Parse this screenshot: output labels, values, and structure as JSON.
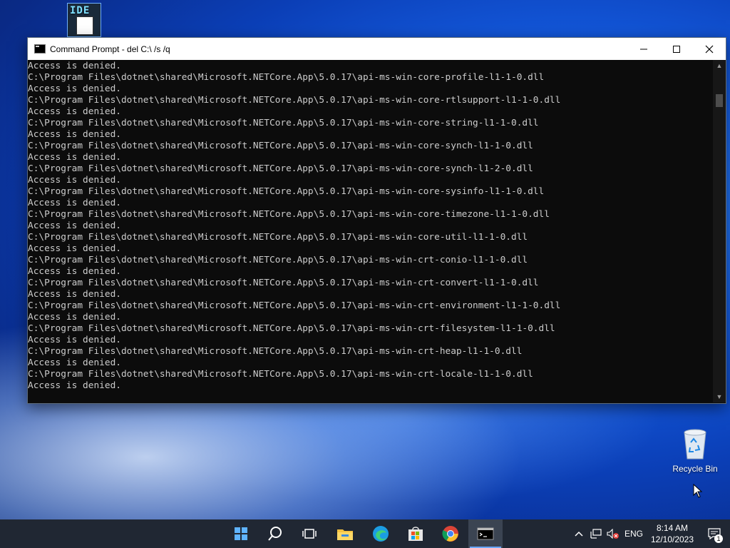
{
  "desktop": {
    "icons": [
      {
        "label": "Recycle Bin"
      }
    ]
  },
  "window": {
    "title": "Command Prompt - del  C:\\ /s /q",
    "controls": {
      "minimize": "—",
      "maximize": "☐",
      "close": "✕"
    }
  },
  "console": {
    "lines": [
      "Access is denied.",
      "C:\\Program Files\\dotnet\\shared\\Microsoft.NETCore.App\\5.0.17\\api-ms-win-core-profile-l1-1-0.dll",
      "Access is denied.",
      "C:\\Program Files\\dotnet\\shared\\Microsoft.NETCore.App\\5.0.17\\api-ms-win-core-rtlsupport-l1-1-0.dll",
      "Access is denied.",
      "C:\\Program Files\\dotnet\\shared\\Microsoft.NETCore.App\\5.0.17\\api-ms-win-core-string-l1-1-0.dll",
      "Access is denied.",
      "C:\\Program Files\\dotnet\\shared\\Microsoft.NETCore.App\\5.0.17\\api-ms-win-core-synch-l1-1-0.dll",
      "Access is denied.",
      "C:\\Program Files\\dotnet\\shared\\Microsoft.NETCore.App\\5.0.17\\api-ms-win-core-synch-l1-2-0.dll",
      "Access is denied.",
      "C:\\Program Files\\dotnet\\shared\\Microsoft.NETCore.App\\5.0.17\\api-ms-win-core-sysinfo-l1-1-0.dll",
      "Access is denied.",
      "C:\\Program Files\\dotnet\\shared\\Microsoft.NETCore.App\\5.0.17\\api-ms-win-core-timezone-l1-1-0.dll",
      "Access is denied.",
      "C:\\Program Files\\dotnet\\shared\\Microsoft.NETCore.App\\5.0.17\\api-ms-win-core-util-l1-1-0.dll",
      "Access is denied.",
      "C:\\Program Files\\dotnet\\shared\\Microsoft.NETCore.App\\5.0.17\\api-ms-win-crt-conio-l1-1-0.dll",
      "Access is denied.",
      "C:\\Program Files\\dotnet\\shared\\Microsoft.NETCore.App\\5.0.17\\api-ms-win-crt-convert-l1-1-0.dll",
      "Access is denied.",
      "C:\\Program Files\\dotnet\\shared\\Microsoft.NETCore.App\\5.0.17\\api-ms-win-crt-environment-l1-1-0.dll",
      "Access is denied.",
      "C:\\Program Files\\dotnet\\shared\\Microsoft.NETCore.App\\5.0.17\\api-ms-win-crt-filesystem-l1-1-0.dll",
      "Access is denied.",
      "C:\\Program Files\\dotnet\\shared\\Microsoft.NETCore.App\\5.0.17\\api-ms-win-crt-heap-l1-1-0.dll",
      "Access is denied.",
      "C:\\Program Files\\dotnet\\shared\\Microsoft.NETCore.App\\5.0.17\\api-ms-win-crt-locale-l1-1-0.dll",
      "Access is denied."
    ]
  },
  "taskbar": {
    "apps": [
      {
        "name": "start-icon"
      },
      {
        "name": "search-icon"
      },
      {
        "name": "task-view-icon"
      },
      {
        "name": "file-explorer-icon"
      },
      {
        "name": "edge-icon"
      },
      {
        "name": "store-icon"
      },
      {
        "name": "chrome-icon"
      },
      {
        "name": "command-prompt-icon",
        "active": true
      }
    ],
    "tray": {
      "language": "ENG",
      "time": "8:14 AM",
      "date": "12/10/2023",
      "notification_count": "1"
    }
  },
  "colors": {
    "console_bg": "#0c0c0c",
    "console_text": "#cccccc",
    "taskbar_bg": "#202733",
    "accent": "#6aa7ff"
  }
}
